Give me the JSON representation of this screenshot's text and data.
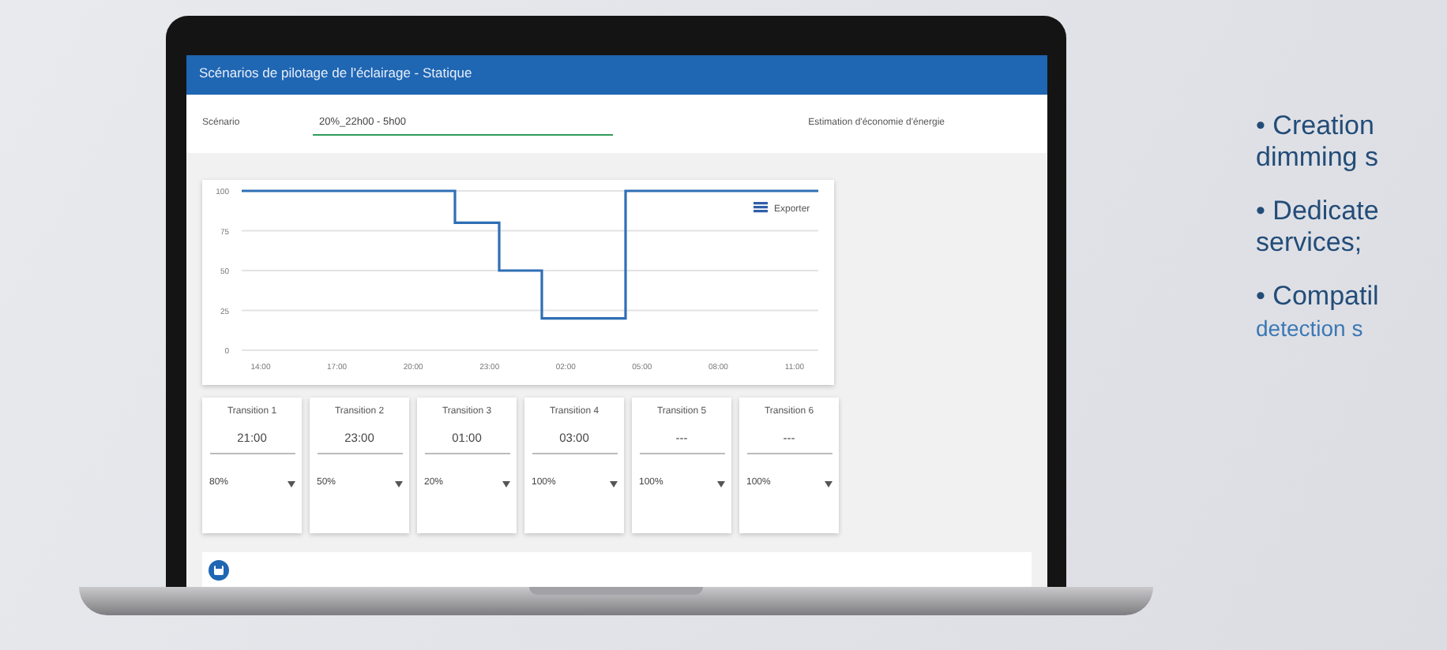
{
  "window": {
    "title": "Scénarios de pilotage de l'éclairage - Statique"
  },
  "scenario": {
    "label": "Scénario",
    "value": "20%_22h00 - 5h00",
    "estimate_link": "Estimation d'économie d'énergie"
  },
  "chart": {
    "legend": "Exporter",
    "y_axis_labels": [
      "100",
      "75",
      "50",
      "25",
      "0"
    ],
    "x_axis_labels": [
      "14:00",
      "17:00",
      "20:00",
      "23:00",
      "02:00",
      "05:00",
      "08:00",
      "11:00"
    ]
  },
  "transitions": [
    {
      "label": "Transition 1",
      "time": "21:00",
      "level": "80%"
    },
    {
      "label": "Transition 2",
      "time": "23:00",
      "level": "50%"
    },
    {
      "label": "Transition 3",
      "time": "01:00",
      "level": "20%"
    },
    {
      "label": "Transition 4",
      "time": "03:00",
      "level": "100%"
    },
    {
      "label": "Transition 5",
      "time": "---",
      "level": "100%"
    },
    {
      "label": "Transition 6",
      "time": "---",
      "level": "100%"
    }
  ],
  "features": [
    {
      "lines": [
        "• Creation",
        "dimming s"
      ]
    },
    {
      "lines": [
        "• Dedicate",
        "services;"
      ]
    },
    {
      "lines": [
        "• Compatil",
        "detection s"
      ]
    }
  ]
}
